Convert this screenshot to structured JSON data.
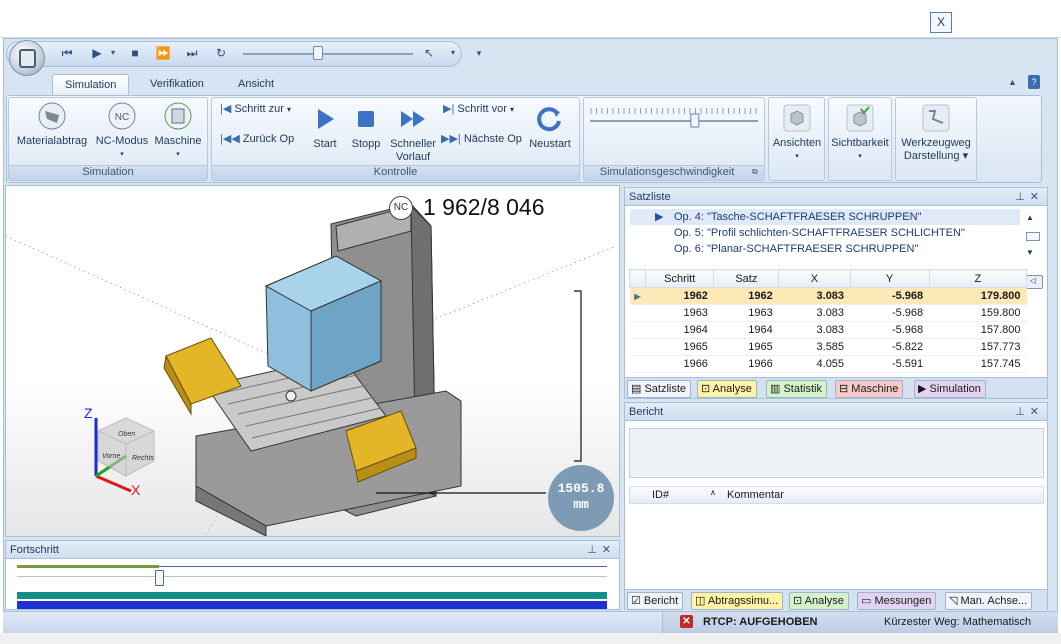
{
  "window": {
    "close_label": "X"
  },
  "quick_access": {
    "icons": [
      "skip-to-start-icon",
      "play-icon",
      "stop-icon",
      "fast-forward-icon",
      "skip-to-end-icon",
      "rewind-icon"
    ],
    "speed_fraction": 0.42
  },
  "ribbon": {
    "tabs": [
      {
        "label": "Simulation"
      },
      {
        "label": "Verifikation"
      },
      {
        "label": "Ansicht"
      }
    ],
    "groups": {
      "simulation": {
        "title": "Simulation",
        "buttons": {
          "materialabtrag": "Materialabtrag",
          "nc_modus": "NC-Modus",
          "maschine": "Maschine"
        }
      },
      "kontrolle": {
        "title": "Kontrolle",
        "schritt_zur": "Schritt zur",
        "zurueck_op": "Zurück Op",
        "start": "Start",
        "stopp": "Stopp",
        "schneller_1": "Schneller",
        "schneller_2": "Vorlauf",
        "schritt_vor": "Schritt vor",
        "naechste_op": "Nächste Op",
        "neustart": "Neustart"
      },
      "speed": {
        "title": "Simulationsgeschwindigkeit",
        "value_fraction": 0.63
      },
      "view": {
        "ansichten": "Ansichten",
        "sichtbarkeit": "Sichtbarkeit",
        "werkzeugweg_1": "Werkzeugweg",
        "werkzeugweg_2": "Darstellung"
      }
    }
  },
  "viewport": {
    "nc_badge": "NC",
    "block_counter": "1 962/8 046",
    "distance_value": "1505.8",
    "distance_unit": "mm",
    "axes": {
      "z": "Z",
      "x": "X"
    },
    "cube_labels": {
      "top": "Oben",
      "front": "Vorne",
      "right": "Rechts"
    }
  },
  "satzliste": {
    "title": "Satzliste",
    "operations": [
      {
        "label": "Op. 4: \"Tasche-SCHAFTFRAESER SCHRUPPEN\"",
        "current": true
      },
      {
        "label": "Op. 5: \"Profil schlichten-SCHAFTFRAESER SCHLICHTEN\"",
        "current": false
      },
      {
        "label": "Op. 6: \"Planar-SCHAFTFRAESER SCHRUPPEN\"",
        "current": false
      }
    ],
    "columns": [
      "Schritt",
      "Satz",
      "X",
      "Y",
      "Z"
    ],
    "rows": [
      [
        "1962",
        "1962",
        "3.083",
        "-5.968",
        "179.800"
      ],
      [
        "1963",
        "1963",
        "3.083",
        "-5.968",
        "159.800"
      ],
      [
        "1964",
        "1964",
        "3.083",
        "-5.968",
        "157.800"
      ],
      [
        "1965",
        "1965",
        "3.585",
        "-5.822",
        "157.773"
      ],
      [
        "1966",
        "1966",
        "4.055",
        "-5.591",
        "157.745"
      ]
    ],
    "current_row": 0,
    "tabs": [
      {
        "label": "Satzliste",
        "color": "#f0f4fa"
      },
      {
        "label": "Analyse",
        "color": "#fff3a6"
      },
      {
        "label": "Statistik",
        "color": "#d6f2c8"
      },
      {
        "label": "Maschine",
        "color": "#f7c9c9"
      },
      {
        "label": "Simulation",
        "color": "#e3d3f2"
      }
    ]
  },
  "bericht": {
    "title": "Bericht",
    "columns": [
      "ID#",
      "Kommentar"
    ],
    "tabs": [
      {
        "label": "Bericht",
        "color": "#f0f4fa"
      },
      {
        "label": "Abtragssimu...",
        "color": "#fff3a6"
      },
      {
        "label": "Analyse",
        "color": "#d6f2c8"
      },
      {
        "label": "Messungen",
        "color": "#e3d3f2"
      },
      {
        "label": "Man. Achse...",
        "color": "#f0f4fa"
      }
    ]
  },
  "fortschritt": {
    "title": "Fortschritt",
    "progress_fraction": 0.24
  },
  "status": {
    "rtcp": "RTCP: AUFGEHOBEN",
    "path_mode": "Kürzester Weg: Mathematisch",
    "error_color": "#c62828"
  },
  "colors": {
    "accent_blue": "#1e395b",
    "progress_teal": "#14908a",
    "progress_blue": "#1f2fd6"
  }
}
